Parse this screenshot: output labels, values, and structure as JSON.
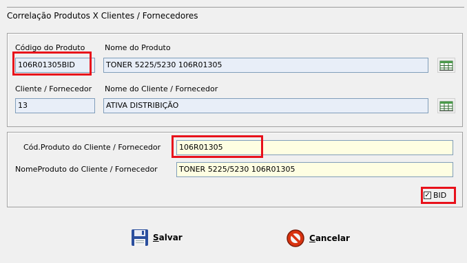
{
  "window": {
    "title": "Correlação Produtos X Clientes / Fornecedores"
  },
  "product_group": {
    "code_label": "Código do Produto",
    "code_value": "106R01305BID",
    "name_label": "Nome do Produto",
    "name_value": "TONER 5225/5230 106R01305",
    "client_code_label": "Cliente / Fornecedor",
    "client_code_value": "13",
    "client_name_label": "Nome do Cliente / Fornecedor",
    "client_name_value": "ATIVA DISTRIBIÇÃO"
  },
  "client_product_group": {
    "code_label": "Cód.Produto do Cliente / Fornecedor",
    "code_value": "106R01305",
    "name_label": "NomeProduto do Cliente / Fornecedor",
    "name_value": "TONER 5225/5230 106R01305",
    "bid_label": "BID",
    "bid_checked": true
  },
  "buttons": {
    "save_underline": "S",
    "save_rest": "alvar",
    "cancel_underline": "C",
    "cancel_rest": "ancelar"
  },
  "colors": {
    "highlight": "#e8101a",
    "field_blue": "#e8eef8",
    "field_yellow": "#fefee2"
  },
  "icons": {
    "lookup": "grid-lookup-icon",
    "save": "floppy-disk-icon",
    "cancel": "cancel-circle-icon"
  }
}
